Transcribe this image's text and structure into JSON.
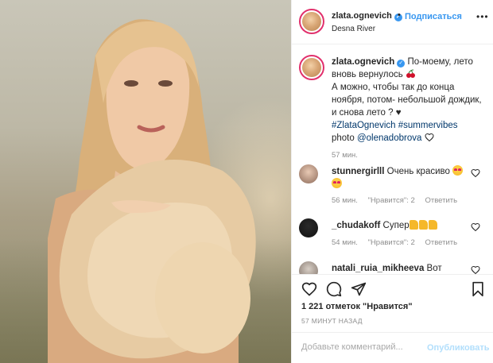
{
  "post": {
    "username": "zlata.ognevich",
    "follow_label": "Подписаться",
    "location": "Desna River",
    "caption": {
      "username": "zlata.ognevich",
      "line1": "По-моему, лето",
      "line2": "вновь вернулось",
      "line3": "А можно, чтобы так до конца",
      "line4": "ноября, потом- небольшой дождик,",
      "line5": "и снова лето ? ♥",
      "hashtags": "#ZlataOgnevich #summervibes",
      "photo_prefix": "photo",
      "photo_credit": "@olenadobrova",
      "time": "57 мин."
    },
    "comments": [
      {
        "username": "stunnergirlll",
        "text": "Очень красиво",
        "time": "56 мин.",
        "likes": "\"Нравится\": 2",
        "reply": "Ответить"
      },
      {
        "username": "_chudakoff",
        "text": "Супер",
        "time": "54 мин.",
        "likes": "\"Нравится\": 2",
        "reply": "Ответить"
      },
      {
        "username": "natali_ruia_mikheeva",
        "text": "Вот"
      }
    ],
    "likes_count": "1 221 отметок \"Нравится\"",
    "posted_ago": "57 МИНУТ НАЗАД",
    "comment_placeholder": "Добавьте комментарий...",
    "publish_label": "Опубликовать"
  },
  "icons": {
    "verified": "verified-badge-icon",
    "more": "more-options-icon",
    "like": "heart-icon",
    "comment": "comment-icon",
    "share": "share-icon",
    "save": "bookmark-icon"
  }
}
